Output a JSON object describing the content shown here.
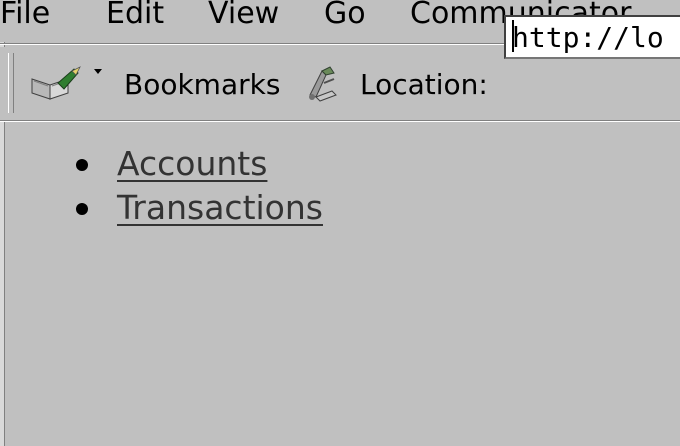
{
  "menubar": {
    "items": [
      {
        "label": "File"
      },
      {
        "label": "Edit"
      },
      {
        "label": "View"
      },
      {
        "label": "Go"
      },
      {
        "label": "Communicator"
      }
    ]
  },
  "toolbar": {
    "bookmarks_icon": "bookmarks-icon",
    "bookmarks_label": "Bookmarks",
    "location_icon": "location-icon",
    "location_label": "Location:",
    "url_value": "http://lo"
  },
  "content": {
    "links": [
      {
        "label": "Accounts"
      },
      {
        "label": "Transactions"
      }
    ]
  },
  "colors": {
    "background": "#c0c0c0",
    "link": "#333333"
  }
}
